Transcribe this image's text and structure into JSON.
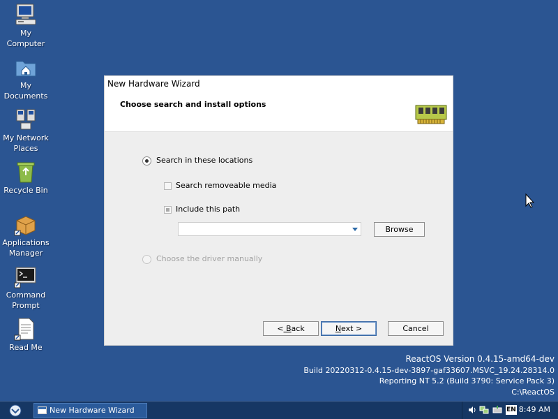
{
  "desktop": {
    "icons": [
      {
        "label_1": "My",
        "label_2": "Computer",
        "icon": "computer-icon"
      },
      {
        "label_1": "My",
        "label_2": "Documents",
        "icon": "documents-folder-icon"
      },
      {
        "label_1": "My Network",
        "label_2": "Places",
        "icon": "network-icon"
      },
      {
        "label_1": "Recycle Bin",
        "label_2": "",
        "icon": "recycle-bin-icon"
      },
      {
        "label_1": "Applications",
        "label_2": "Manager",
        "icon": "package-icon"
      },
      {
        "label_1": "Command",
        "label_2": "Prompt",
        "icon": "terminal-icon"
      },
      {
        "label_1": "Read Me",
        "label_2": "",
        "icon": "document-icon"
      }
    ]
  },
  "wizard": {
    "title": "New Hardware Wizard",
    "subtitle": "Choose search and install options",
    "options": {
      "search_locations": "Search in these locations",
      "search_media": "Search removeable media",
      "include_path": "Include this path",
      "choose_manually": "Choose the driver manually"
    },
    "path_value": "",
    "buttons": {
      "browse": "Browse",
      "back_prefix": "<",
      "back_accel": " B",
      "back_rest": "ack",
      "next_accel": "N",
      "next_rest": "ext >",
      "cancel": "Cancel"
    }
  },
  "version": {
    "line1": "ReactOS Version 0.4.15-amd64-dev",
    "line2": "Build 20220312-0.4.15-dev-3897-gaf33607.MSVC_19.24.28314.0",
    "line3": "Reporting NT 5.2 (Build 3790: Service Pack 3)",
    "line4": "C:\\ReactOS"
  },
  "taskbar": {
    "task_label": "New Hardware Wizard",
    "language": "EN",
    "clock": "8:49 AM"
  },
  "colors": {
    "desktop": "#2b5592",
    "taskbar": "#163764",
    "dialog": "#eeeeee",
    "accent": "#3b6aa6"
  }
}
